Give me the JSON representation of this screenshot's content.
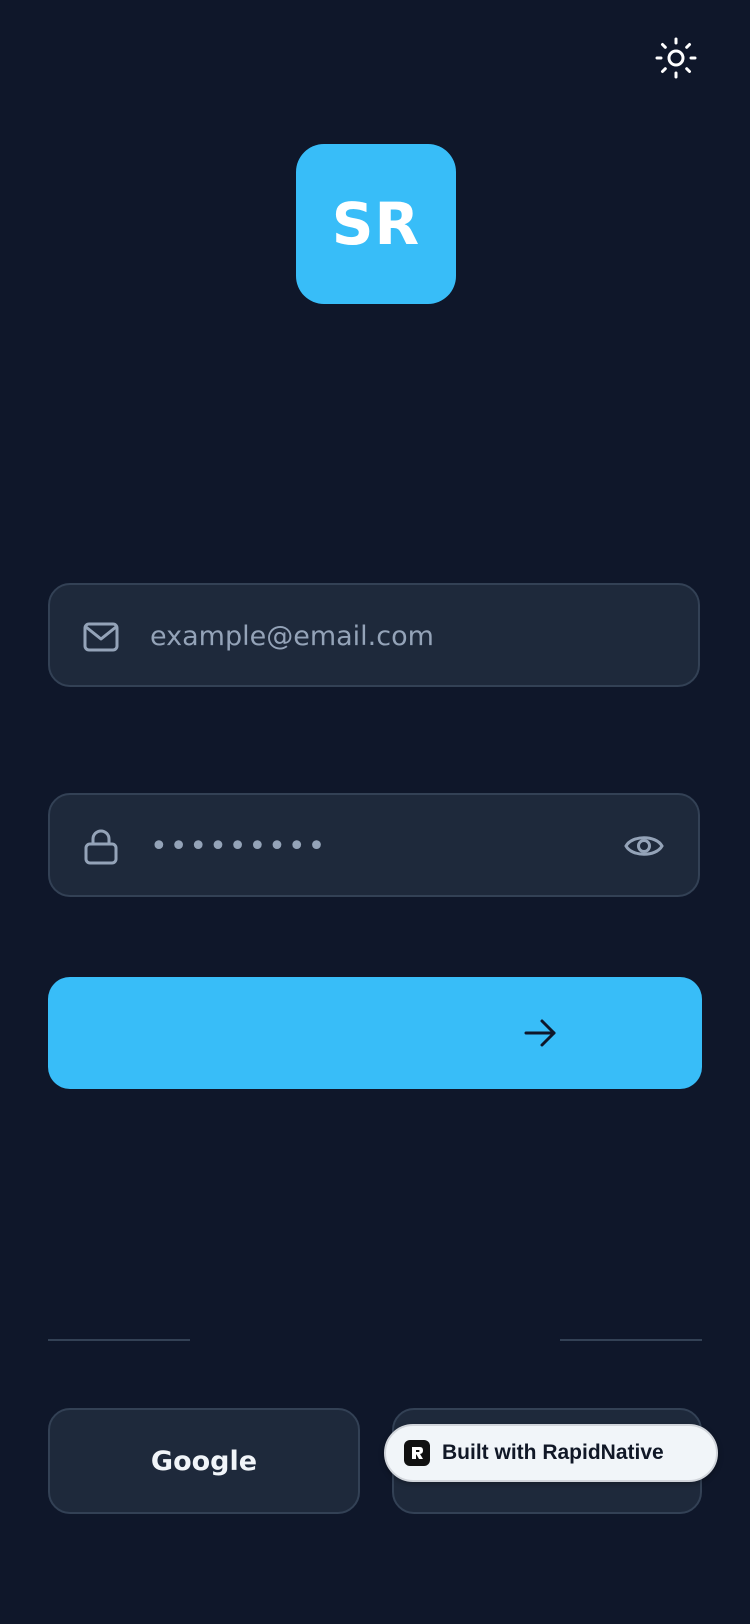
{
  "header": {
    "theme_icon": "sun-icon"
  },
  "logo": {
    "text": "SR",
    "color": "#38bdf8"
  },
  "email": {
    "placeholder": "example@email.com",
    "icon": "mail-icon"
  },
  "password": {
    "value": "•••••••••",
    "icon": "lock-icon",
    "toggle_icon": "eye-icon"
  },
  "submit": {
    "icon": "arrow-right-icon",
    "color": "#38bdf8"
  },
  "social": {
    "google_label": "Google",
    "second_label": ""
  },
  "badge": {
    "label": "Built with RapidNative"
  },
  "colors": {
    "background": "#0f172a",
    "field": "#1e293b",
    "border": "#334155",
    "accent": "#38bdf8"
  }
}
